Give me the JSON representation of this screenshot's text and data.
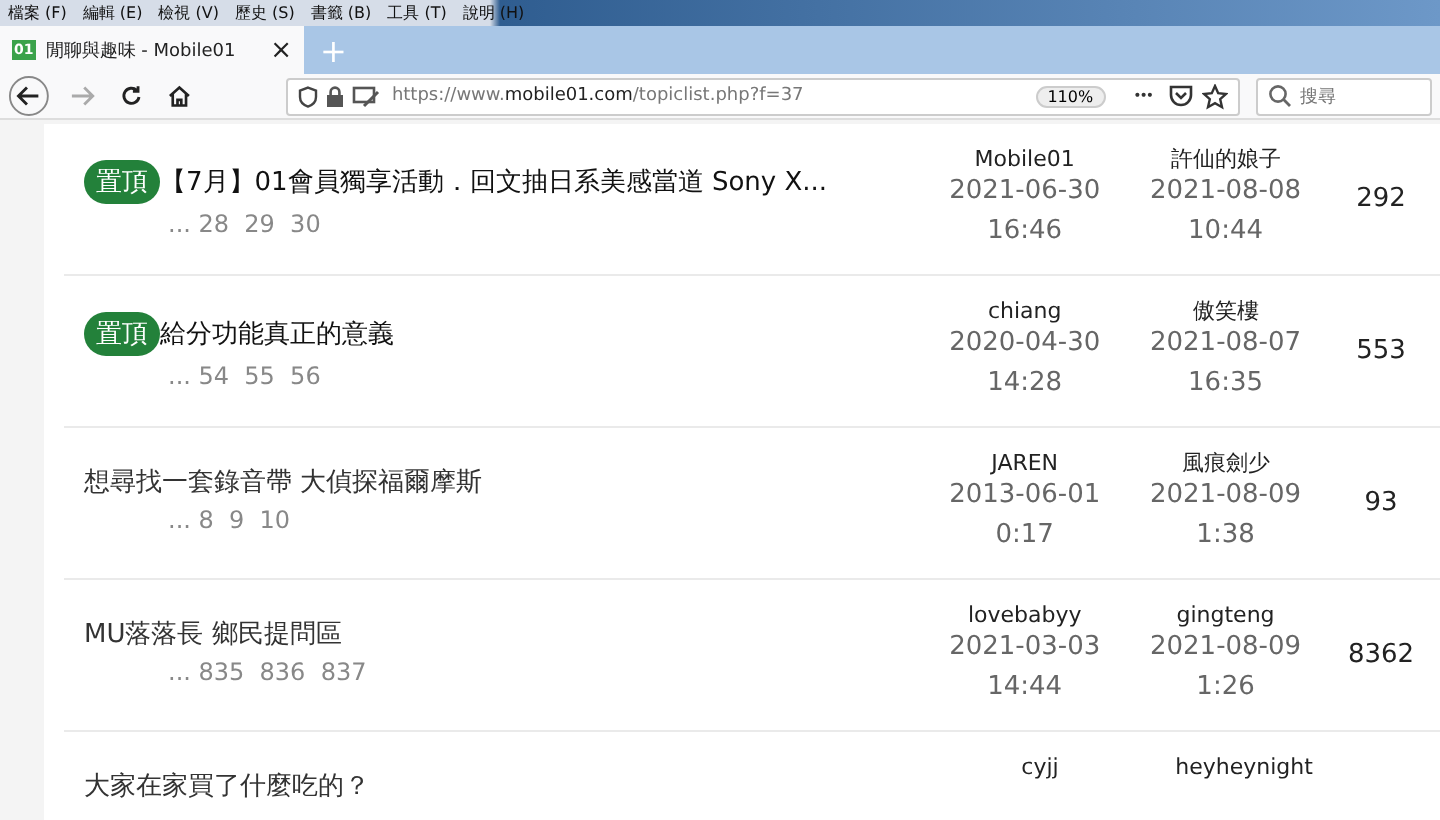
{
  "menu_bar": [
    "檔案 (F)",
    "編輯 (E)",
    "檢視 (V)",
    "歷史 (S)",
    "書籤 (B)",
    "工具 (T)",
    "說明 (H)"
  ],
  "tab": {
    "favicon": "01",
    "title": "閒聊與趣味 - Mobile01",
    "close": "×"
  },
  "new_tab": "+",
  "address_bar": {
    "url": "https://www.**mobile01.com**/topiclist.php?f=37",
    "zoom": "110%",
    "more": "•••"
  },
  "search": {
    "placeholder": "搜尋"
  },
  "topics": [
    {
      "pinned": true,
      "badge": "置頂",
      "title": "【7月】01會員獨享活動．回文抽日系美感當道 Sony X...",
      "pages": "... 28  29  30",
      "author": "Mobile01",
      "created_date": "2021-06-30",
      "created_time": "16:46",
      "last_user": "許仙的娘子",
      "last_date": "2021-08-08",
      "last_time": "10:44",
      "replies": "292"
    },
    {
      "pinned": true,
      "badge": "置頂",
      "title": "給分功能真正的意義",
      "pages": "... 54  55  56",
      "author": "chiang",
      "created_date": "2020-04-30",
      "created_time": "14:28",
      "last_user": "傲笑樓",
      "last_date": "2021-08-07",
      "last_time": "16:35",
      "replies": "553"
    },
    {
      "pinned": false,
      "title": "想尋找一套錄音帶  大偵探福爾摩斯",
      "pages": "... 8  9  10",
      "author": "JAREN",
      "created_date": "2013-06-01",
      "created_time": "0:17",
      "last_user": "風痕劍少",
      "last_date": "2021-08-09",
      "last_time": "1:38",
      "replies": "93"
    },
    {
      "pinned": false,
      "title": "MU落落長 鄉民提問區",
      "pages": "... 835  836  837",
      "author": "lovebabyy",
      "created_date": "2021-03-03",
      "created_time": "14:44",
      "last_user": "gingteng",
      "last_date": "2021-08-09",
      "last_time": "1:26",
      "replies": "8362"
    },
    {
      "pinned": false,
      "title": "大家在家買了什麼吃的？",
      "author": "cyjj",
      "last_user": "heyheynight"
    }
  ]
}
